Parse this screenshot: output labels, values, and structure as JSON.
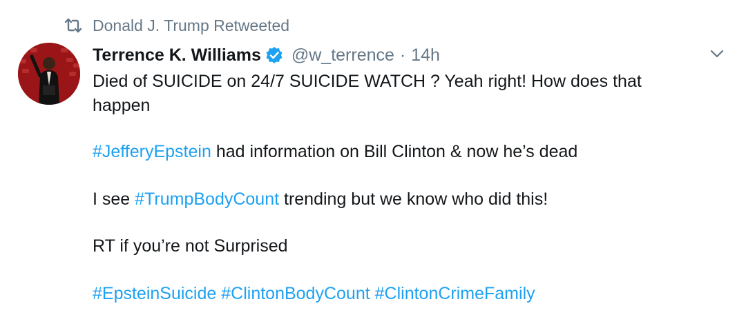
{
  "retweet_context": {
    "text": "Donald J. Trump Retweeted",
    "icon": "retweet-icon"
  },
  "tweet": {
    "author_name": "Terrence K. Williams",
    "verified_icon": "verified-badge-icon",
    "handle": "@w_terrence",
    "separator": "·",
    "time": "14h",
    "more_icon": "chevron-down-icon",
    "line1": "Died of SUICIDE on 24/7 SUICIDE WATCH ? Yeah right! How does that",
    "line2": "happen",
    "para2": {
      "hashtag": "#JefferyEpstein",
      "text": " had information on Bill Clinton & now he’s dead"
    },
    "para3": {
      "prefix": "I see ",
      "hashtag": "#TrumpBodyCount",
      "suffix": " trending but we know who did this!"
    },
    "para4": "RT if you’re not Surprised",
    "para5": {
      "hashtag1": "#EpsteinSuicide",
      "hashtag2": "#ClintonBodyCount",
      "hashtag3": "#ClintonCrimeFamily"
    }
  },
  "colors": {
    "text": "#14171a",
    "muted": "#657786",
    "link": "#1da1f2",
    "verified": "#1da1f2"
  }
}
